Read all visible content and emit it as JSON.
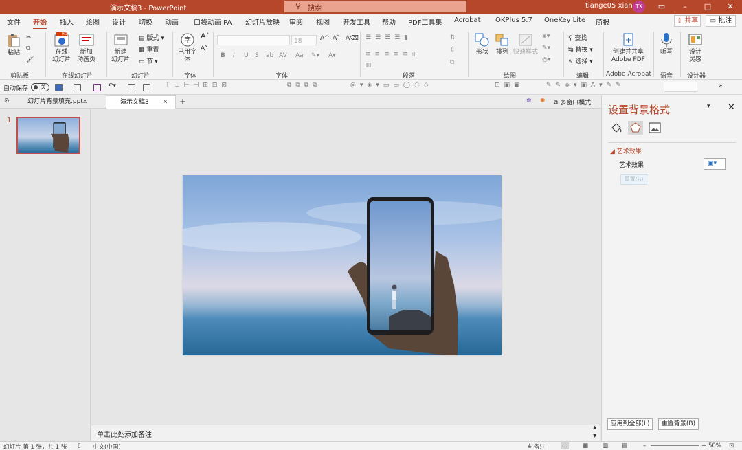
{
  "title_bar": {
    "doc_title": "演示文稿3  -  PowerPoint",
    "search_placeholder": "搜索",
    "user": "tiange05 xiang",
    "avatar": "TX"
  },
  "tabs": [
    "文件",
    "开始",
    "插入",
    "绘图",
    "设计",
    "切换",
    "动画",
    "口袋动画 PA",
    "幻灯片放映",
    "审阅",
    "视图",
    "开发工具",
    "帮助",
    "PDF工具集",
    "Acrobat",
    "OKPlus 5.7",
    "OneKey Lite",
    "简报"
  ],
  "active_tab": "开始",
  "header_buttons": {
    "share": "共享",
    "comments": "批注"
  },
  "ribbon": {
    "groups": [
      "剪贴板",
      "在线幻灯片",
      "幻灯片",
      "字体",
      "段落",
      "绘图",
      "编辑",
      "Adobe Acrobat",
      "语音",
      "设计器"
    ],
    "paste": "粘贴",
    "online_slides": "在线\n幻灯片",
    "new_online_page": "新加\n动画页",
    "new_slide": "新建\n幻灯片",
    "layout": "版式",
    "reset": "重置",
    "section": "节",
    "font_convert": "已用字\n体",
    "font_size": "18",
    "badge": "HOT",
    "shapes": "形状",
    "arrange": "排列",
    "quick_styles": "快速样式",
    "find": "查找",
    "replace": "替换",
    "select": "选择",
    "create_pdf": "创建并共享\nAdobe PDF",
    "dictate": "听写",
    "designer": "设计\n灵感"
  },
  "quick_access": {
    "autosave": "自动保存",
    "toggle": "关"
  },
  "doc_tabs": [
    {
      "name": "幻灯片背景填充.pptx",
      "active": false
    },
    {
      "name": "演示文稿3",
      "active": true
    }
  ],
  "multi_window": "多窗口模式",
  "slide_pane": {
    "slide_number": "1"
  },
  "notes_placeholder": "单击此处添加备注",
  "format_pane": {
    "title": "设置背景格式",
    "section": "艺术效果",
    "label": "艺术效果",
    "reset": "重置(R)",
    "apply_all": "应用到全部(L)",
    "reset_bg": "重置背景(B)"
  },
  "status_bar": {
    "slide_info": "幻灯片 第 1 张，共 1 张",
    "language": "中文(中国)",
    "notes": "备注",
    "zoom": "50%"
  },
  "colors": {
    "accent": "#b7472a",
    "pane_bg": "#f3f3f3"
  }
}
